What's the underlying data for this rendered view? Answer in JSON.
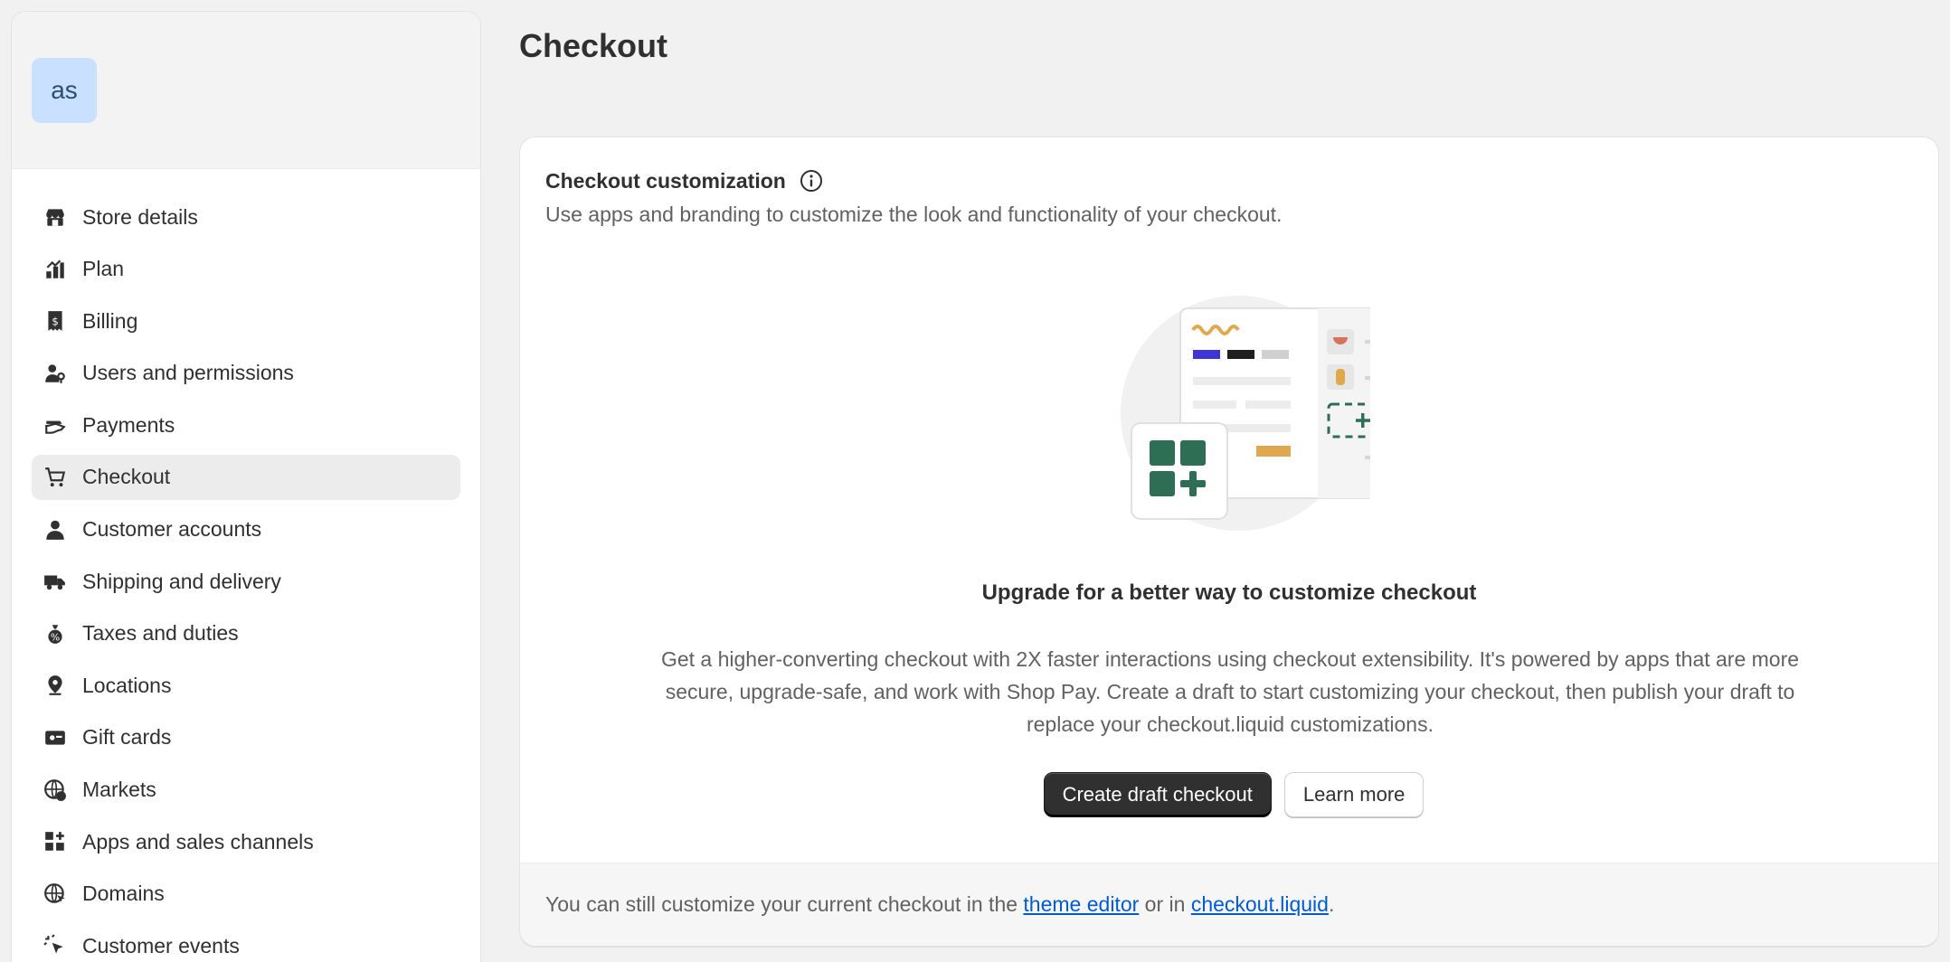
{
  "sidebar": {
    "avatar_text": "as",
    "items": [
      {
        "label": "Store details",
        "icon": "store-icon"
      },
      {
        "label": "Plan",
        "icon": "plan-icon"
      },
      {
        "label": "Billing",
        "icon": "billing-icon"
      },
      {
        "label": "Users and permissions",
        "icon": "users-icon"
      },
      {
        "label": "Payments",
        "icon": "payments-icon"
      },
      {
        "label": "Checkout",
        "icon": "cart-icon",
        "active": true
      },
      {
        "label": "Customer accounts",
        "icon": "person-icon"
      },
      {
        "label": "Shipping and delivery",
        "icon": "truck-icon"
      },
      {
        "label": "Taxes and duties",
        "icon": "money-bag-icon"
      },
      {
        "label": "Locations",
        "icon": "location-icon"
      },
      {
        "label": "Gift cards",
        "icon": "gift-card-icon"
      },
      {
        "label": "Markets",
        "icon": "globe-dollar-icon"
      },
      {
        "label": "Apps and sales channels",
        "icon": "apps-icon"
      },
      {
        "label": "Domains",
        "icon": "globe-cursor-icon"
      },
      {
        "label": "Customer events",
        "icon": "cursor-click-icon"
      }
    ]
  },
  "main": {
    "page_title": "Checkout",
    "card": {
      "title": "Checkout customization",
      "subtitle": "Use apps and branding to customize the look and functionality of your checkout.",
      "upgrade_title": "Upgrade for a better way to customize checkout",
      "upgrade_body": "Get a higher-converting checkout with 2X faster interactions using checkout extensibility. It's powered by apps that are more secure, upgrade-safe, and work with Shop Pay. Create a draft to start customizing your checkout, then publish your draft to replace your checkout.liquid customizations.",
      "primary_button": "Create draft checkout",
      "secondary_button": "Learn more",
      "footer": {
        "prefix": "You can still customize your current checkout in the ",
        "link1": "theme editor",
        "middle": " or in ",
        "link2": "checkout.liquid",
        "suffix": "."
      }
    }
  },
  "colors": {
    "accent_green": "#2e6e55",
    "link_blue": "#005bd3",
    "primary_button_bg": "#303030"
  }
}
